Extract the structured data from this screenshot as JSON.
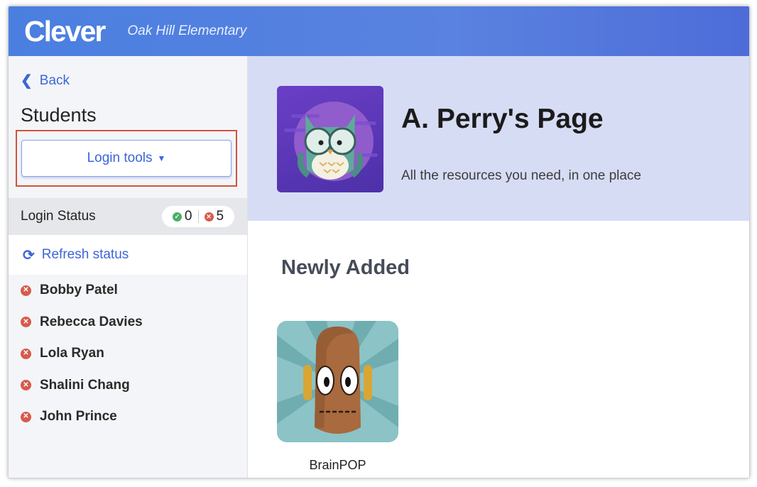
{
  "header": {
    "logo_text": "Clever",
    "school_name": "Oak Hill Elementary"
  },
  "sidebar": {
    "back_label": "Back",
    "title": "Students",
    "login_tools_label": "Login tools",
    "login_status": {
      "label": "Login Status",
      "logged_in_count": "0",
      "not_logged_in_count": "5"
    },
    "refresh_label": "Refresh status",
    "students": [
      {
        "name": "Bobby Patel"
      },
      {
        "name": "Rebecca Davies"
      },
      {
        "name": "Lola Ryan"
      },
      {
        "name": "Shalini Chang"
      },
      {
        "name": "John Prince"
      }
    ]
  },
  "main": {
    "page_title": "A. Perry's Page",
    "page_subtitle": "All the resources you need, in one place",
    "section_title": "Newly Added",
    "apps": [
      {
        "name": "BrainPOP",
        "icon": "brainpop-moby-icon"
      }
    ]
  },
  "colors": {
    "brand_blue": "#4a7fe0",
    "link_blue": "#3c65d8",
    "highlight_red": "#d1533e",
    "status_green": "#4caf66",
    "status_red": "#d85a4b",
    "hero_bg": "#d7dcf5"
  }
}
